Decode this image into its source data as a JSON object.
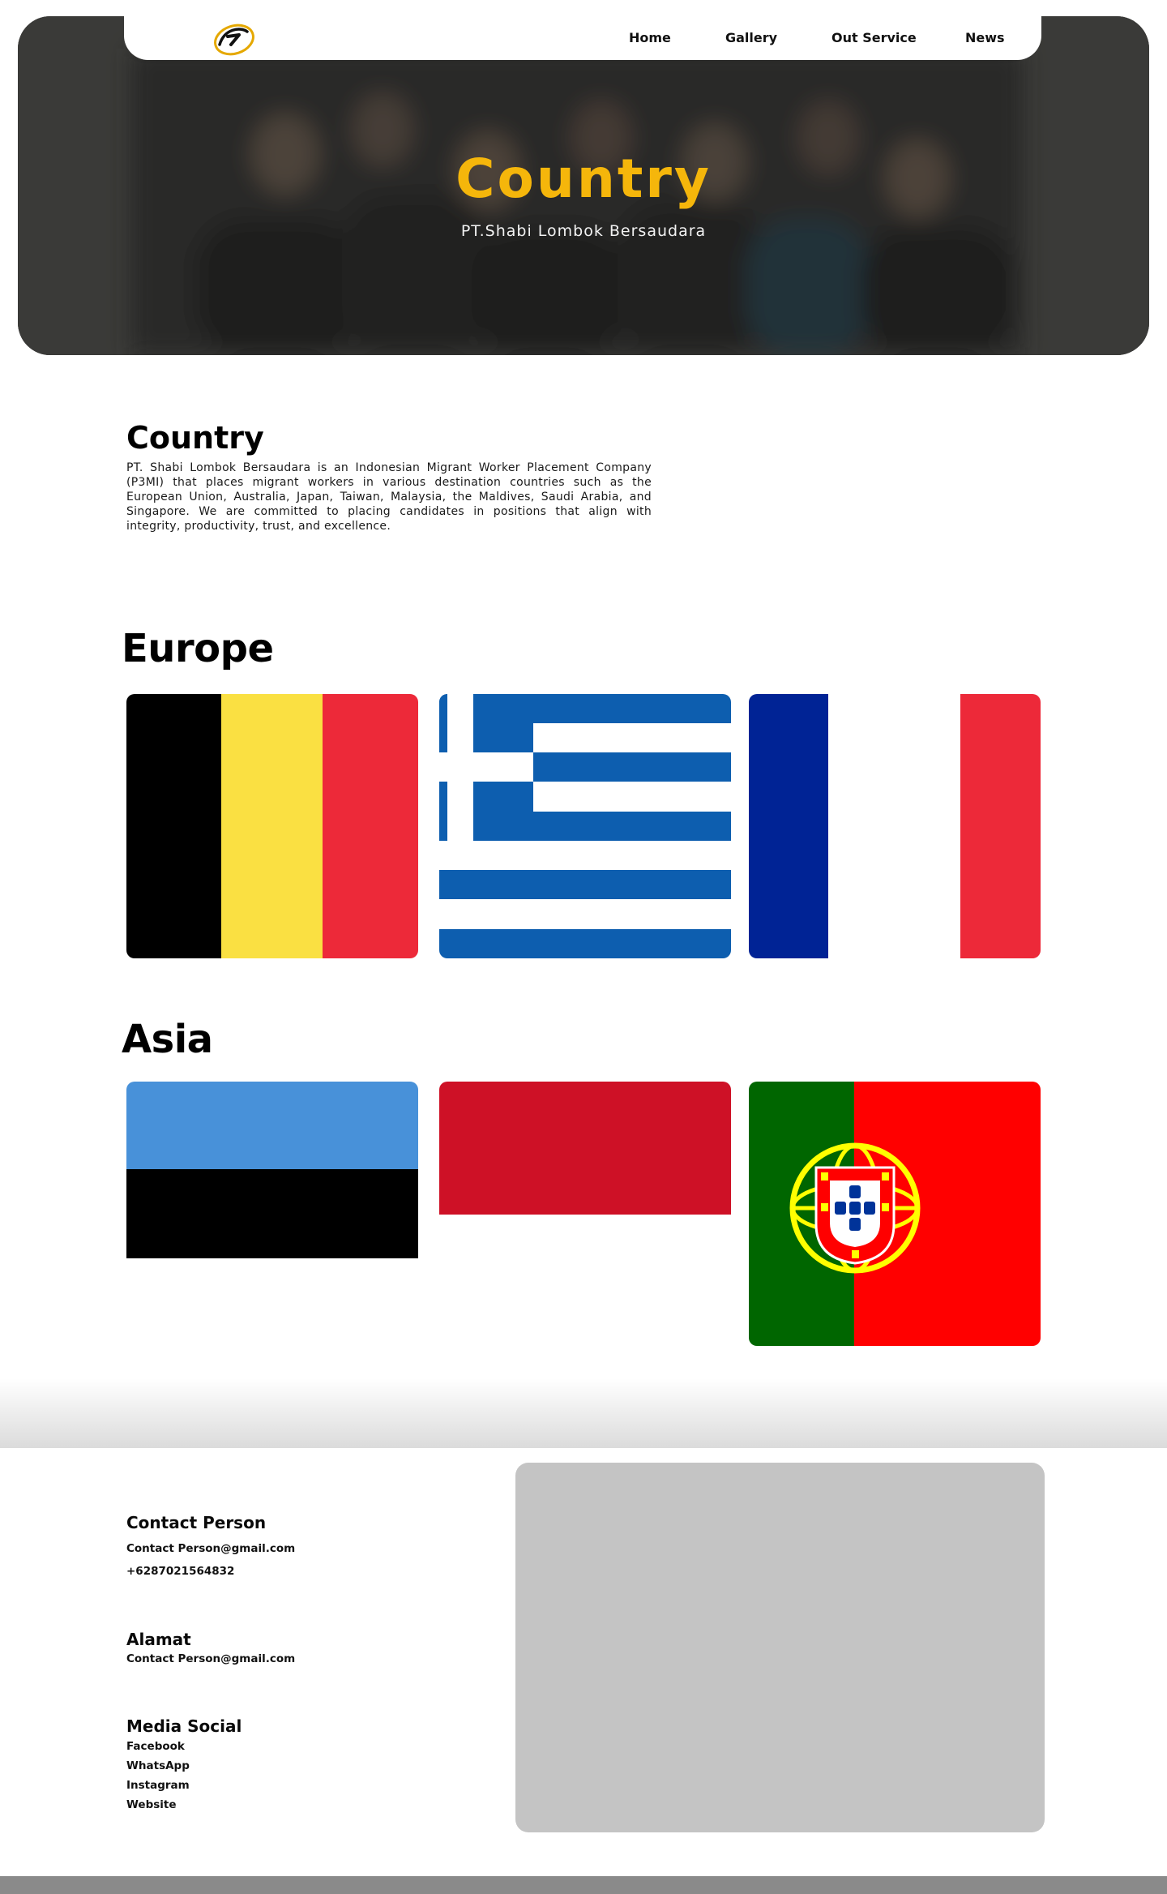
{
  "nav": {
    "items": [
      {
        "label": "Home"
      },
      {
        "label": "Gallery"
      },
      {
        "label": "Out Service"
      },
      {
        "label": "News"
      }
    ]
  },
  "hero": {
    "title": "Country",
    "subtitle": "PT.Shabi Lombok Bersaudara"
  },
  "intro": {
    "title": "Country",
    "text": "PT. Shabi Lombok Bersaudara is an Indonesian Migrant Worker Placement Company (P3MI) that places migrant workers in various destination countries such as the European Union, Australia, Japan, Taiwan, Malaysia, the Maldives, Saudi Arabia, and Singapore. We are committed to placing candidates in positions that align with integrity, productivity, trust, and excellence."
  },
  "regions": [
    {
      "title": "Europe",
      "flags": [
        "belgium-flag",
        "greece-flag",
        "france-flag"
      ]
    },
    {
      "title": "Asia",
      "flags": [
        "estonia-flag",
        "indonesia-flag",
        "portugal-flag"
      ]
    }
  ],
  "colors": {
    "accent": "#f5b60b",
    "belgium": [
      "#000000",
      "#fae042",
      "#ed2939"
    ],
    "greece": "#0d5eaf",
    "france": [
      "#002395",
      "#ffffff",
      "#ed2939"
    ],
    "estonia": [
      "#4891d9",
      "#000000",
      "#ffffff"
    ],
    "indonesia": "#ce1126",
    "portugal": [
      "#006600",
      "#ff0000"
    ],
    "map_placeholder": "#c4c4c4"
  },
  "footer": {
    "contact": {
      "title": "Contact Person",
      "email": "Contact Person@gmail.com",
      "phone": "+6287021564832"
    },
    "address": {
      "title": "Alamat",
      "value": "Contact Person@gmail.com"
    },
    "social": {
      "title": "Media Social",
      "links": [
        "Facebook",
        "WhatsApp",
        "Instagram",
        "Website"
      ]
    }
  }
}
